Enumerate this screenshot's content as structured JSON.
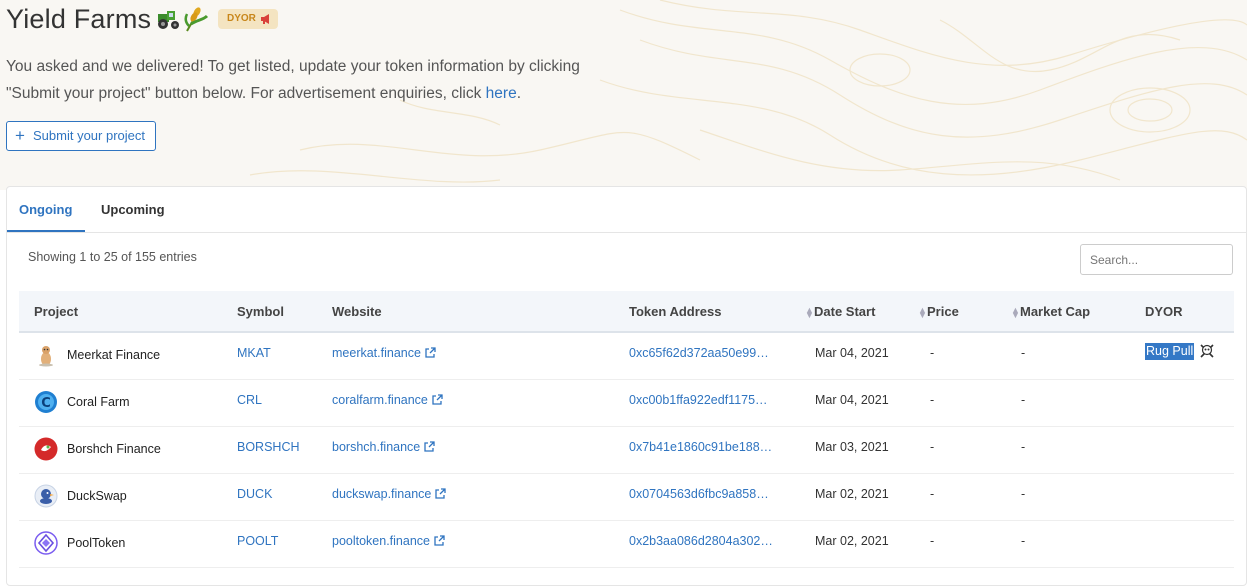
{
  "page": {
    "title": "Yield Farms",
    "badge": "DYOR",
    "description_text": "You asked and we delivered! To get listed, update your token information by clicking \"Submit your project\" button below. For advertisement enquiries, click ",
    "description_link": "here",
    "description_end": ".",
    "submit_button": "Submit your project"
  },
  "tabs": [
    {
      "label": "Ongoing",
      "active": true
    },
    {
      "label": "Upcoming",
      "active": false
    }
  ],
  "table": {
    "showing": "Showing 1 to 25 of 155 entries",
    "search_placeholder": "Search...",
    "columns": [
      "Project",
      "Symbol",
      "Website",
      "Token Address",
      "Date Start",
      "Price",
      "Market Cap",
      "DYOR"
    ],
    "rows": [
      {
        "project": "Meerkat Finance",
        "symbol": "MKAT",
        "website": "meerkat.finance",
        "address": "0xc65f62d372aa50e99…",
        "date": "Mar 04, 2021",
        "price": "-",
        "mcap": "-",
        "dyor": "Rug Pull",
        "logo": "meerkat-logo"
      },
      {
        "project": "Coral Farm",
        "symbol": "CRL",
        "website": "coralfarm.finance",
        "address": "0xc00b1ffa922edf1175…",
        "date": "Mar 04, 2021",
        "price": "-",
        "mcap": "-",
        "dyor": "",
        "logo": "coral-logo"
      },
      {
        "project": "Borshch Finance",
        "symbol": "BORSHCH",
        "website": "borshch.finance",
        "address": "0x7b41e1860c91be188…",
        "date": "Mar 03, 2021",
        "price": "-",
        "mcap": "-",
        "dyor": "",
        "logo": "borshch-logo"
      },
      {
        "project": "DuckSwap",
        "symbol": "DUCK",
        "website": "duckswap.finance",
        "address": "0x0704563d6fbc9a858…",
        "date": "Mar 02, 2021",
        "price": "-",
        "mcap": "-",
        "dyor": "",
        "logo": "duck-logo"
      },
      {
        "project": "PoolToken",
        "symbol": "POOLT",
        "website": "pooltoken.finance",
        "address": "0x2b3aa086d2804a302…",
        "date": "Mar 02, 2021",
        "price": "-",
        "mcap": "-",
        "dyor": "",
        "logo": "pool-logo"
      }
    ]
  },
  "colors": {
    "accent": "#2f74c0",
    "badge_bg": "#f4e4c1",
    "badge_text": "#c8861a"
  }
}
